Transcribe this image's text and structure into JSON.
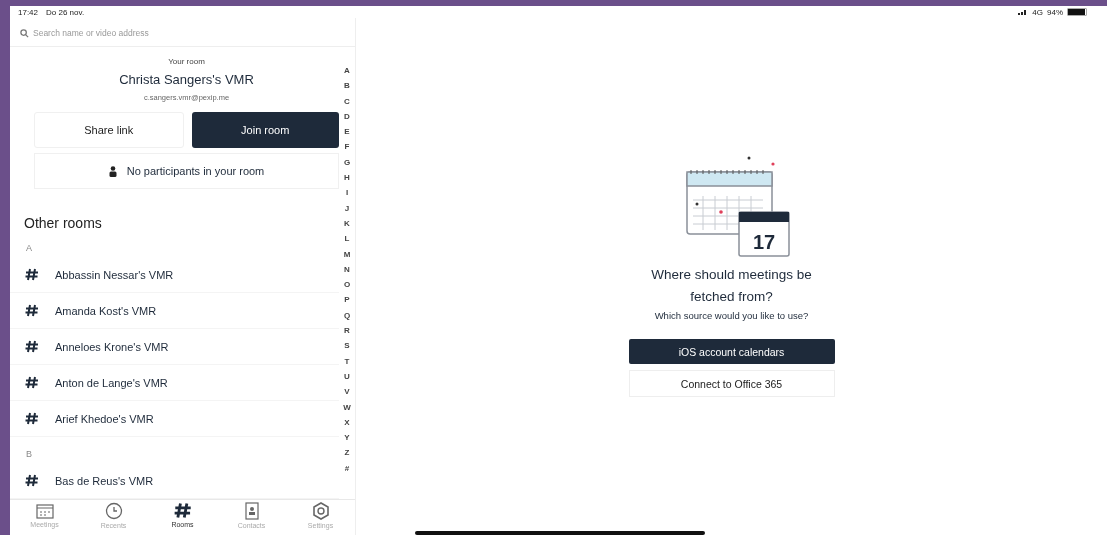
{
  "status_bar": {
    "time": "17:42",
    "date": "Do 26 nov.",
    "network": "4G",
    "battery": "94%"
  },
  "search": {
    "placeholder": "Search name or video address"
  },
  "your_room": {
    "heading": "Your room",
    "name": "Christa Sangers's VMR",
    "address": "c.sangers.vmr@pexip.me",
    "share_button": "Share link",
    "join_button": "Join room",
    "participants": "No participants in your room"
  },
  "other_rooms": {
    "heading": "Other rooms",
    "sections": [
      {
        "letter": "A",
        "rooms": [
          "Abbassin Nessar's VMR",
          "Amanda Kost's VMR",
          "Anneloes Krone's VMR",
          "Anton de Lange's VMR",
          "Arief Khedoe's VMR"
        ]
      },
      {
        "letter": "B",
        "rooms": [
          "Bas de Reus's VMR"
        ]
      }
    ]
  },
  "index": [
    "A",
    "B",
    "C",
    "D",
    "E",
    "F",
    "G",
    "H",
    "I",
    "J",
    "K",
    "L",
    "M",
    "N",
    "O",
    "P",
    "Q",
    "R",
    "S",
    "T",
    "U",
    "V",
    "W",
    "X",
    "Y",
    "Z",
    "#"
  ],
  "tabs": [
    {
      "label": "Meetings",
      "kind": "calendar",
      "selected": false
    },
    {
      "label": "Recents",
      "kind": "clock",
      "selected": false
    },
    {
      "label": "Rooms",
      "kind": "hash",
      "selected": true
    },
    {
      "label": "Contacts",
      "kind": "contacts",
      "selected": false
    },
    {
      "label": "Settings",
      "kind": "gear",
      "selected": false
    }
  ],
  "empty_state": {
    "calendar_day": "17",
    "title": "Where should meetings be fetched from?",
    "subtitle": "Which source would you like to use?",
    "primary_button": "iOS account calendars",
    "secondary_button": "Connect to Office 365"
  }
}
